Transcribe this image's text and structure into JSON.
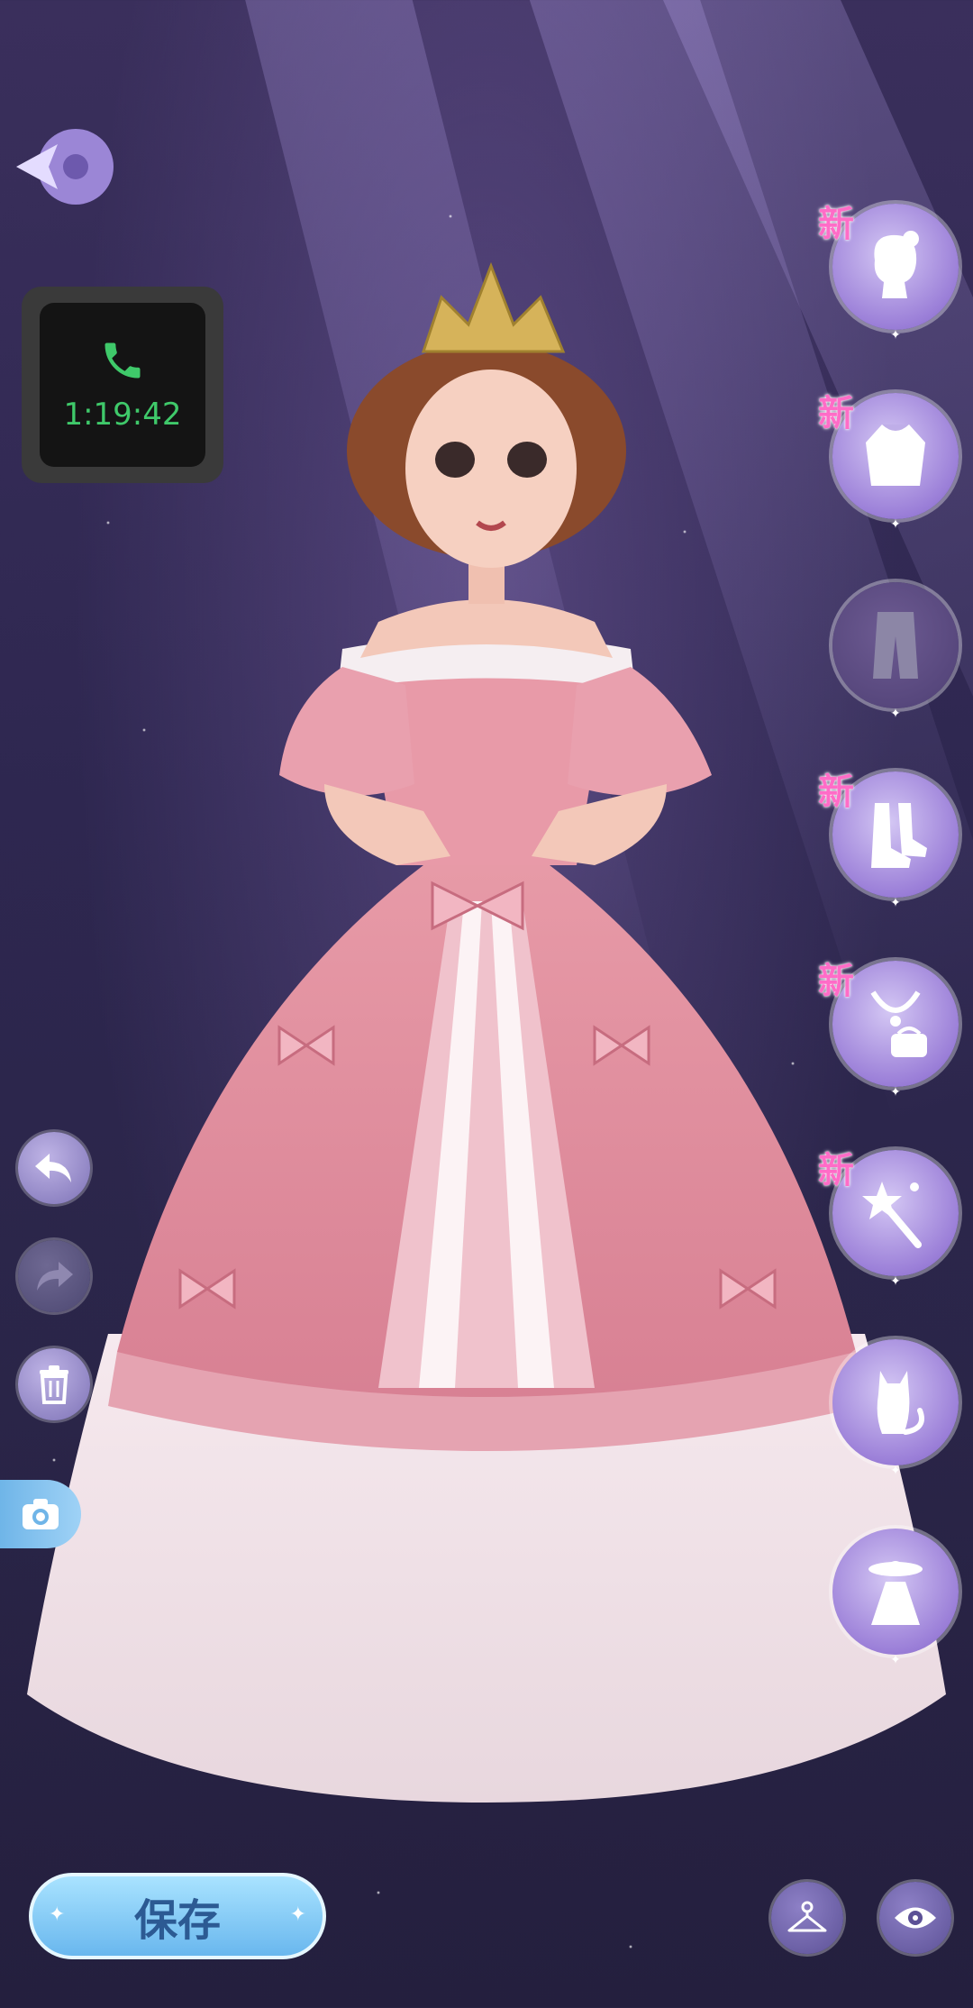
{
  "call_widget": {
    "time": "1:19:42"
  },
  "new_badge": "新",
  "categories": [
    {
      "name": "hair",
      "is_new": true
    },
    {
      "name": "top",
      "is_new": true
    },
    {
      "name": "bottom",
      "is_new": false
    },
    {
      "name": "shoes",
      "is_new": true
    },
    {
      "name": "accessories",
      "is_new": true
    },
    {
      "name": "effects",
      "is_new": true
    },
    {
      "name": "pet",
      "is_new": false
    },
    {
      "name": "suit",
      "is_new": false
    }
  ],
  "save_button": {
    "label": "保存"
  },
  "colors": {
    "accent_purple": "#9b7fd8",
    "save_blue": "#69b7ee",
    "new_pink": "#ff6cc7",
    "call_green": "#3fc96a"
  }
}
